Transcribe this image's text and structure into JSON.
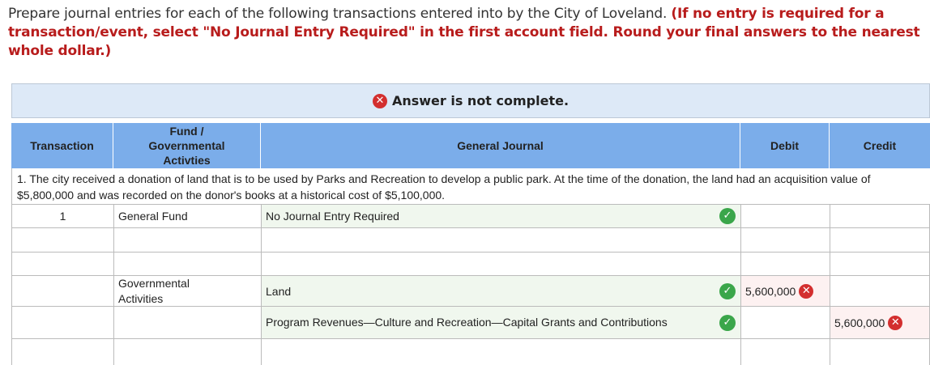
{
  "instructions": {
    "text": "Prepare journal entries for each of the following transactions entered into by the City of Loveland. ",
    "note": "(If no entry is required for a transaction/event, select \"No Journal Entry Required\" in the first account field. Round your final answers to the nearest whole dollar.)"
  },
  "banner": {
    "icon": "x-icon",
    "text": "Answer is not complete."
  },
  "table": {
    "headers": {
      "transaction": "Transaction",
      "fund": "Fund /\nGovernmental\nActivties",
      "journal": "General Journal",
      "debit": "Debit",
      "credit": "Credit"
    },
    "description": "1. The city received a donation of land that is to be used by Parks and Recreation to develop a public park. At the time of the donation, the land had an acquisition value of $5,800,000 and was recorded on the donor's books at a historical cost of $5,100,000.",
    "rows": [
      {
        "transaction": "1",
        "fund": "General Fund",
        "account": "No Journal Entry Required",
        "debit": "",
        "credit": ""
      },
      {
        "transaction": "",
        "fund": "",
        "account": "",
        "debit": "",
        "credit": ""
      },
      {
        "transaction": "",
        "fund": "",
        "account": "",
        "debit": "",
        "credit": ""
      },
      {
        "transaction": "",
        "fund": "Governmental\nActivities",
        "account": "Land",
        "debit": "5,600,000",
        "credit": ""
      },
      {
        "transaction": "",
        "fund": "",
        "account": "Program Revenues—Culture and Recreation—Capital Grants and Contributions",
        "debit": "",
        "credit": "5,600,000"
      },
      {
        "transaction": "",
        "fund": "",
        "account": "",
        "debit": "",
        "credit": ""
      }
    ]
  },
  "colors": {
    "header_bg": "#7badea",
    "banner_bg": "#dde9f7",
    "note_red": "#b81c1c",
    "correct_green": "#3aa64a",
    "incorrect_red": "#d32f2f"
  }
}
